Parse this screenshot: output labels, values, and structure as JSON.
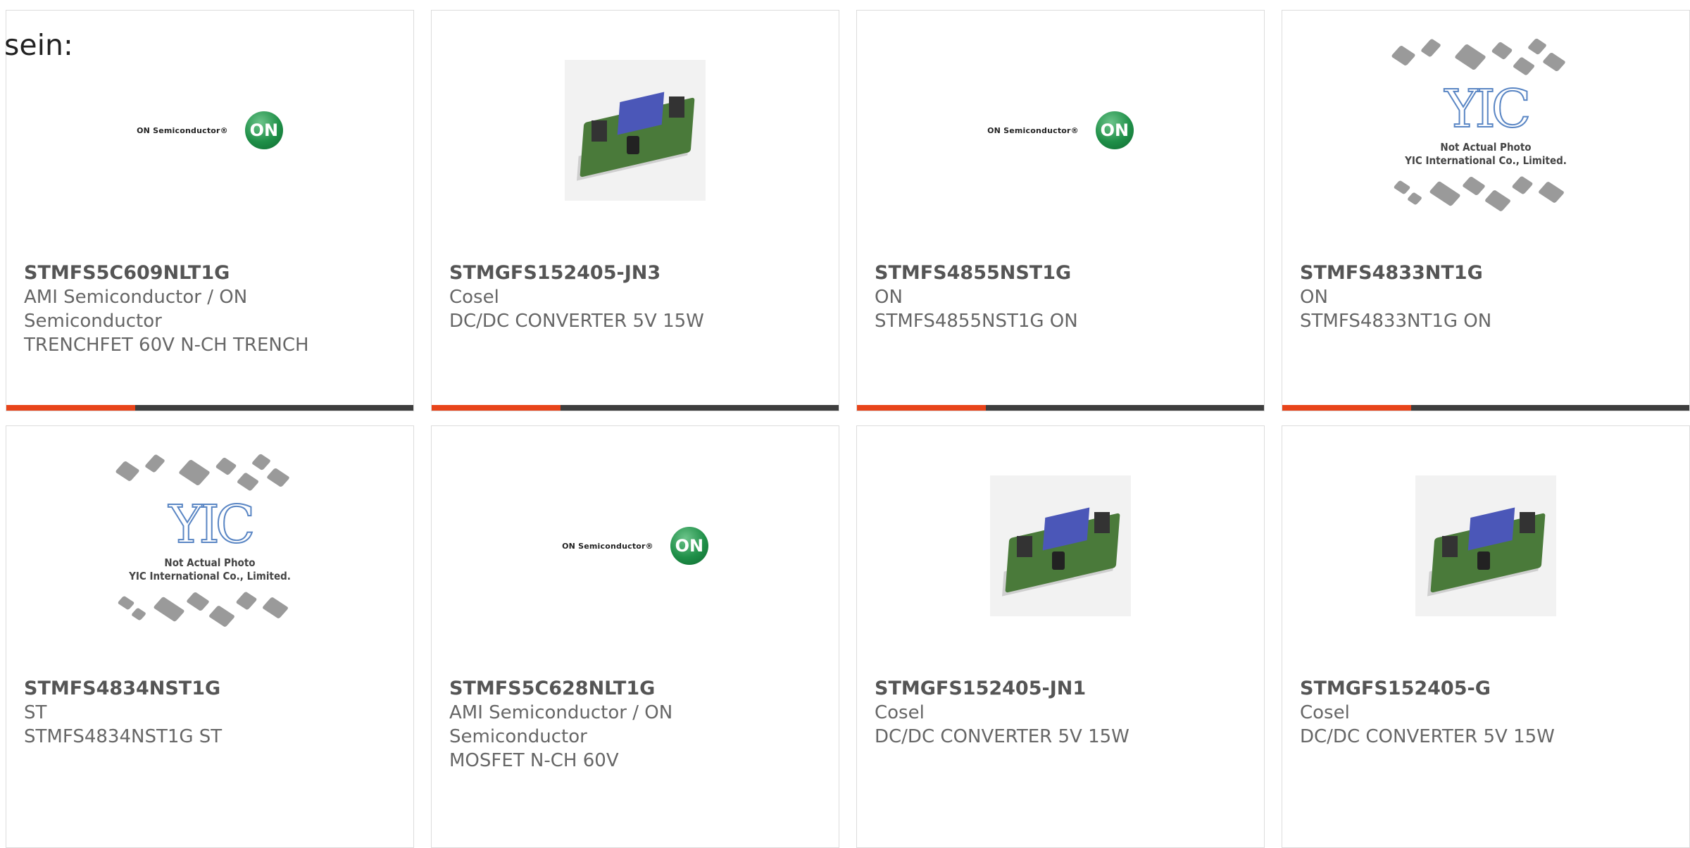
{
  "lead_text": "sein:",
  "accent_color": "#e8441a",
  "bar_color": "#3e3e3e",
  "products": [
    {
      "part": "STMFS5C609NLT1G",
      "line1": "AMI Semiconductor / ON",
      "line2": "Semiconductor",
      "line3": "TRENCHFET 60V N-CH TRENCH",
      "image": "on-semiconductor-logo"
    },
    {
      "part": "STMGFS152405-JN3",
      "line1": "Cosel",
      "line2": "DC/DC CONVERTER 5V 15W",
      "line3": "",
      "image": "dcdc-converter-photo"
    },
    {
      "part": "STMFS4855NST1G",
      "line1": "ON",
      "line2": "STMFS4855NST1G ON",
      "line3": "",
      "image": "on-semiconductor-logo"
    },
    {
      "part": "STMFS4833NT1G",
      "line1": "ON",
      "line2": "STMFS4833NT1G ON",
      "line3": "",
      "image": "yic-not-actual-photo"
    },
    {
      "part": "STMFS4834NST1G",
      "line1": "ST",
      "line2": "STMFS4834NST1G ST",
      "line3": "",
      "image": "yic-not-actual-photo"
    },
    {
      "part": "STMFS5C628NLT1G",
      "line1": "AMI Semiconductor / ON",
      "line2": "Semiconductor",
      "line3": "MOSFET N-CH 60V",
      "image": "on-semiconductor-logo"
    },
    {
      "part": "STMGFS152405-JN1",
      "line1": "Cosel",
      "line2": "DC/DC CONVERTER 5V 15W",
      "line3": "",
      "image": "dcdc-converter-photo"
    },
    {
      "part": "STMGFS152405-G",
      "line1": "Cosel",
      "line2": "DC/DC CONVERTER 5V 15W",
      "line3": "",
      "image": "dcdc-converter-photo"
    }
  ],
  "on_logo": {
    "text": "ON Semiconductor®",
    "badge": "ON"
  },
  "yic_logo": {
    "mark": "YIC",
    "caption1": "Not Actual Photo",
    "caption2": "YIC International Co., Limited."
  }
}
